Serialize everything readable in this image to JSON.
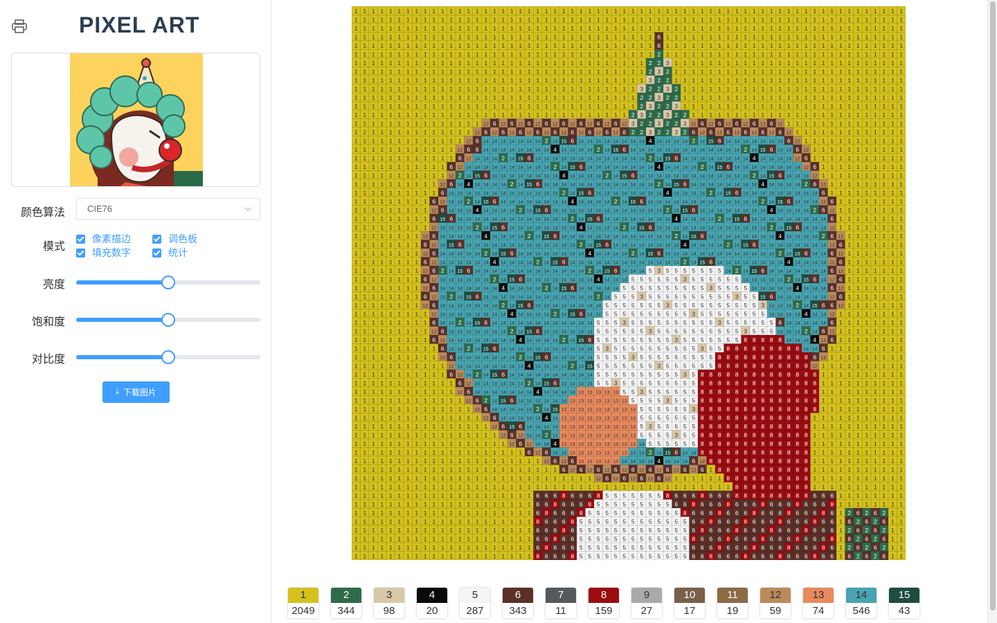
{
  "app": {
    "title": "PIXEL ART",
    "logo_icon": "printer-icon"
  },
  "settings": {
    "algorithm_label": "颜色算法",
    "algorithm_value": "CIE76",
    "mode_label": "模式",
    "modes": [
      {
        "label": "像素描边",
        "checked": true
      },
      {
        "label": "调色板",
        "checked": true
      },
      {
        "label": "填充数字",
        "checked": true
      },
      {
        "label": "统计",
        "checked": true
      }
    ],
    "brightness_label": "亮度",
    "brightness_value": 0.5,
    "saturation_label": "饱和度",
    "saturation_value": 0.5,
    "contrast_label": "对比度",
    "contrast_value": 0.5,
    "download_label": "下载图片",
    "download_icon": "download-icon"
  },
  "palette": [
    {
      "num": "1",
      "color": "#d4c11c",
      "count": "2049",
      "text": "#303133"
    },
    {
      "num": "2",
      "color": "#2e6b4a",
      "count": "344",
      "text": "#ffffff"
    },
    {
      "num": "3",
      "color": "#d8c8a8",
      "count": "98",
      "text": "#303133"
    },
    {
      "num": "4",
      "color": "#0a0a0a",
      "count": "20",
      "text": "#ffffff"
    },
    {
      "num": "5",
      "color": "#f4f4f4",
      "count": "287",
      "text": "#303133"
    },
    {
      "num": "6",
      "color": "#5a3028",
      "count": "343",
      "text": "#ffffff"
    },
    {
      "num": "7",
      "color": "#55585c",
      "count": "11",
      "text": "#ffffff"
    },
    {
      "num": "8",
      "color": "#9a0c10",
      "count": "159",
      "text": "#ffffff"
    },
    {
      "num": "9",
      "color": "#a8aaa8",
      "count": "27",
      "text": "#303133"
    },
    {
      "num": "10",
      "color": "#7a6048",
      "count": "17",
      "text": "#ffffff"
    },
    {
      "num": "11",
      "color": "#8c6a44",
      "count": "19",
      "text": "#ffffff"
    },
    {
      "num": "12",
      "color": "#bb8a5c",
      "count": "59",
      "text": "#303133"
    },
    {
      "num": "13",
      "color": "#e88a5e",
      "count": "74",
      "text": "#303133"
    },
    {
      "num": "14",
      "color": "#47a4b0",
      "count": "546",
      "text": "#303133"
    },
    {
      "num": "15",
      "color": "#1e4c40",
      "count": "43",
      "text": "#ffffff"
    }
  ]
}
